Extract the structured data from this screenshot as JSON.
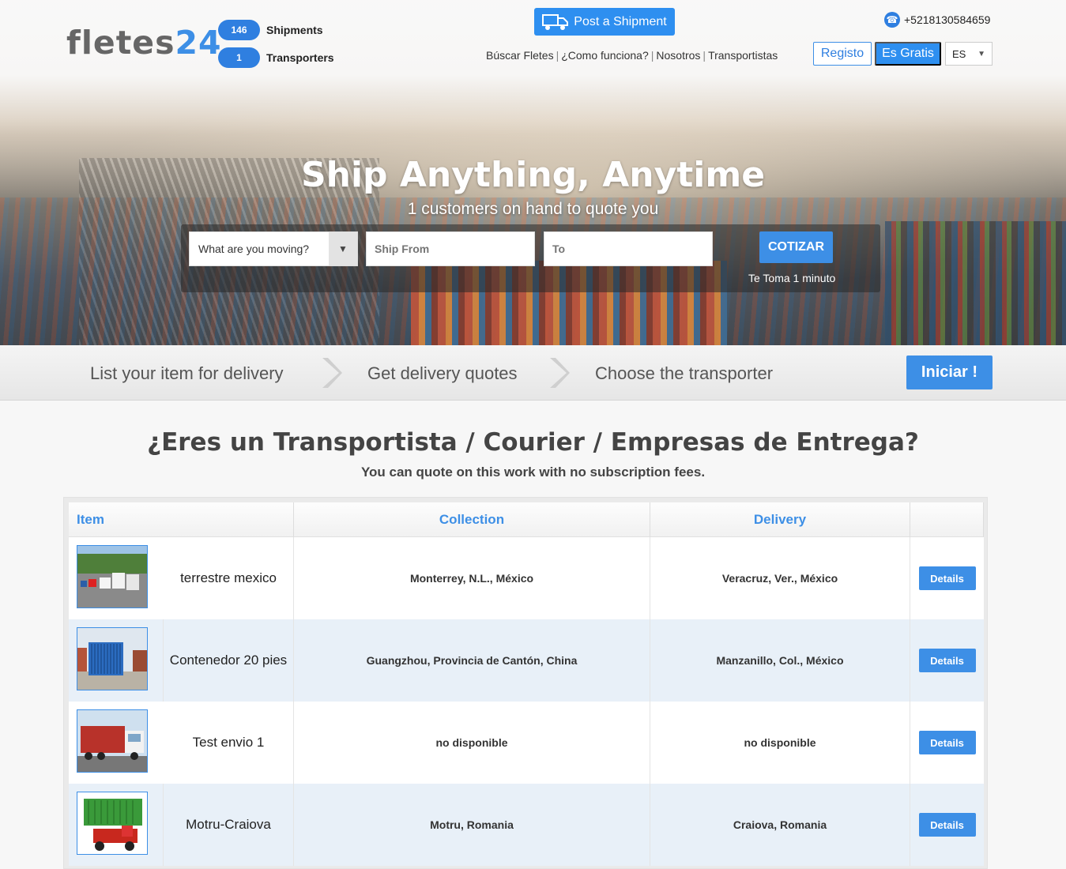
{
  "header": {
    "logo_part1": "fletes",
    "logo_part2": "24",
    "shipments_count": "146",
    "shipments_label": "Shipments",
    "transporters_count": "1",
    "transporters_label": "Transporters",
    "post_button": "Post a Shipment",
    "nav": [
      "Búscar Fletes",
      "¿Como funciona?",
      "Nosotros",
      "Transportistas"
    ],
    "phone": "+5218130584659",
    "registo": "Registo",
    "gratis": "Es Gratis",
    "lang": "ES"
  },
  "hero": {
    "title": "Ship Anything, Anytime",
    "subtitle": "1 customers on hand to quote you",
    "select_value": "What are you moving?",
    "from_placeholder": "Ship From",
    "to_placeholder": "To",
    "cotizar": "COTIZAR",
    "takes": "Te Toma 1 minuto"
  },
  "steps": {
    "step1": "List your item for delivery",
    "step2": "Get delivery quotes",
    "step3": "Choose the transporter",
    "iniciar": "Iniciar !"
  },
  "section": {
    "title": "¿Eres un Transportista / Courier / Empresas de Entrega?",
    "subtitle": "You can quote on this work with no subscription fees."
  },
  "table": {
    "headers": [
      "Item",
      "Collection",
      "Delivery"
    ],
    "details_label": "Details",
    "rows": [
      {
        "item": "terrestre mexico",
        "collection": "Monterrey, N.L., México",
        "delivery": "Veracruz, Ver., México"
      },
      {
        "item": "Contenedor 20 pies",
        "collection": "Guangzhou, Provincia de Cantón, China",
        "delivery": "Manzanillo, Col., México"
      },
      {
        "item": "Test envio 1",
        "collection": "no disponible",
        "delivery": "no disponible"
      },
      {
        "item": "Motru-Craiova",
        "collection": "Motru, Romania",
        "delivery": "Craiova, Romania"
      }
    ]
  },
  "colors": {
    "accent": "#3d8fe6",
    "pill": "#2f7fe0"
  }
}
